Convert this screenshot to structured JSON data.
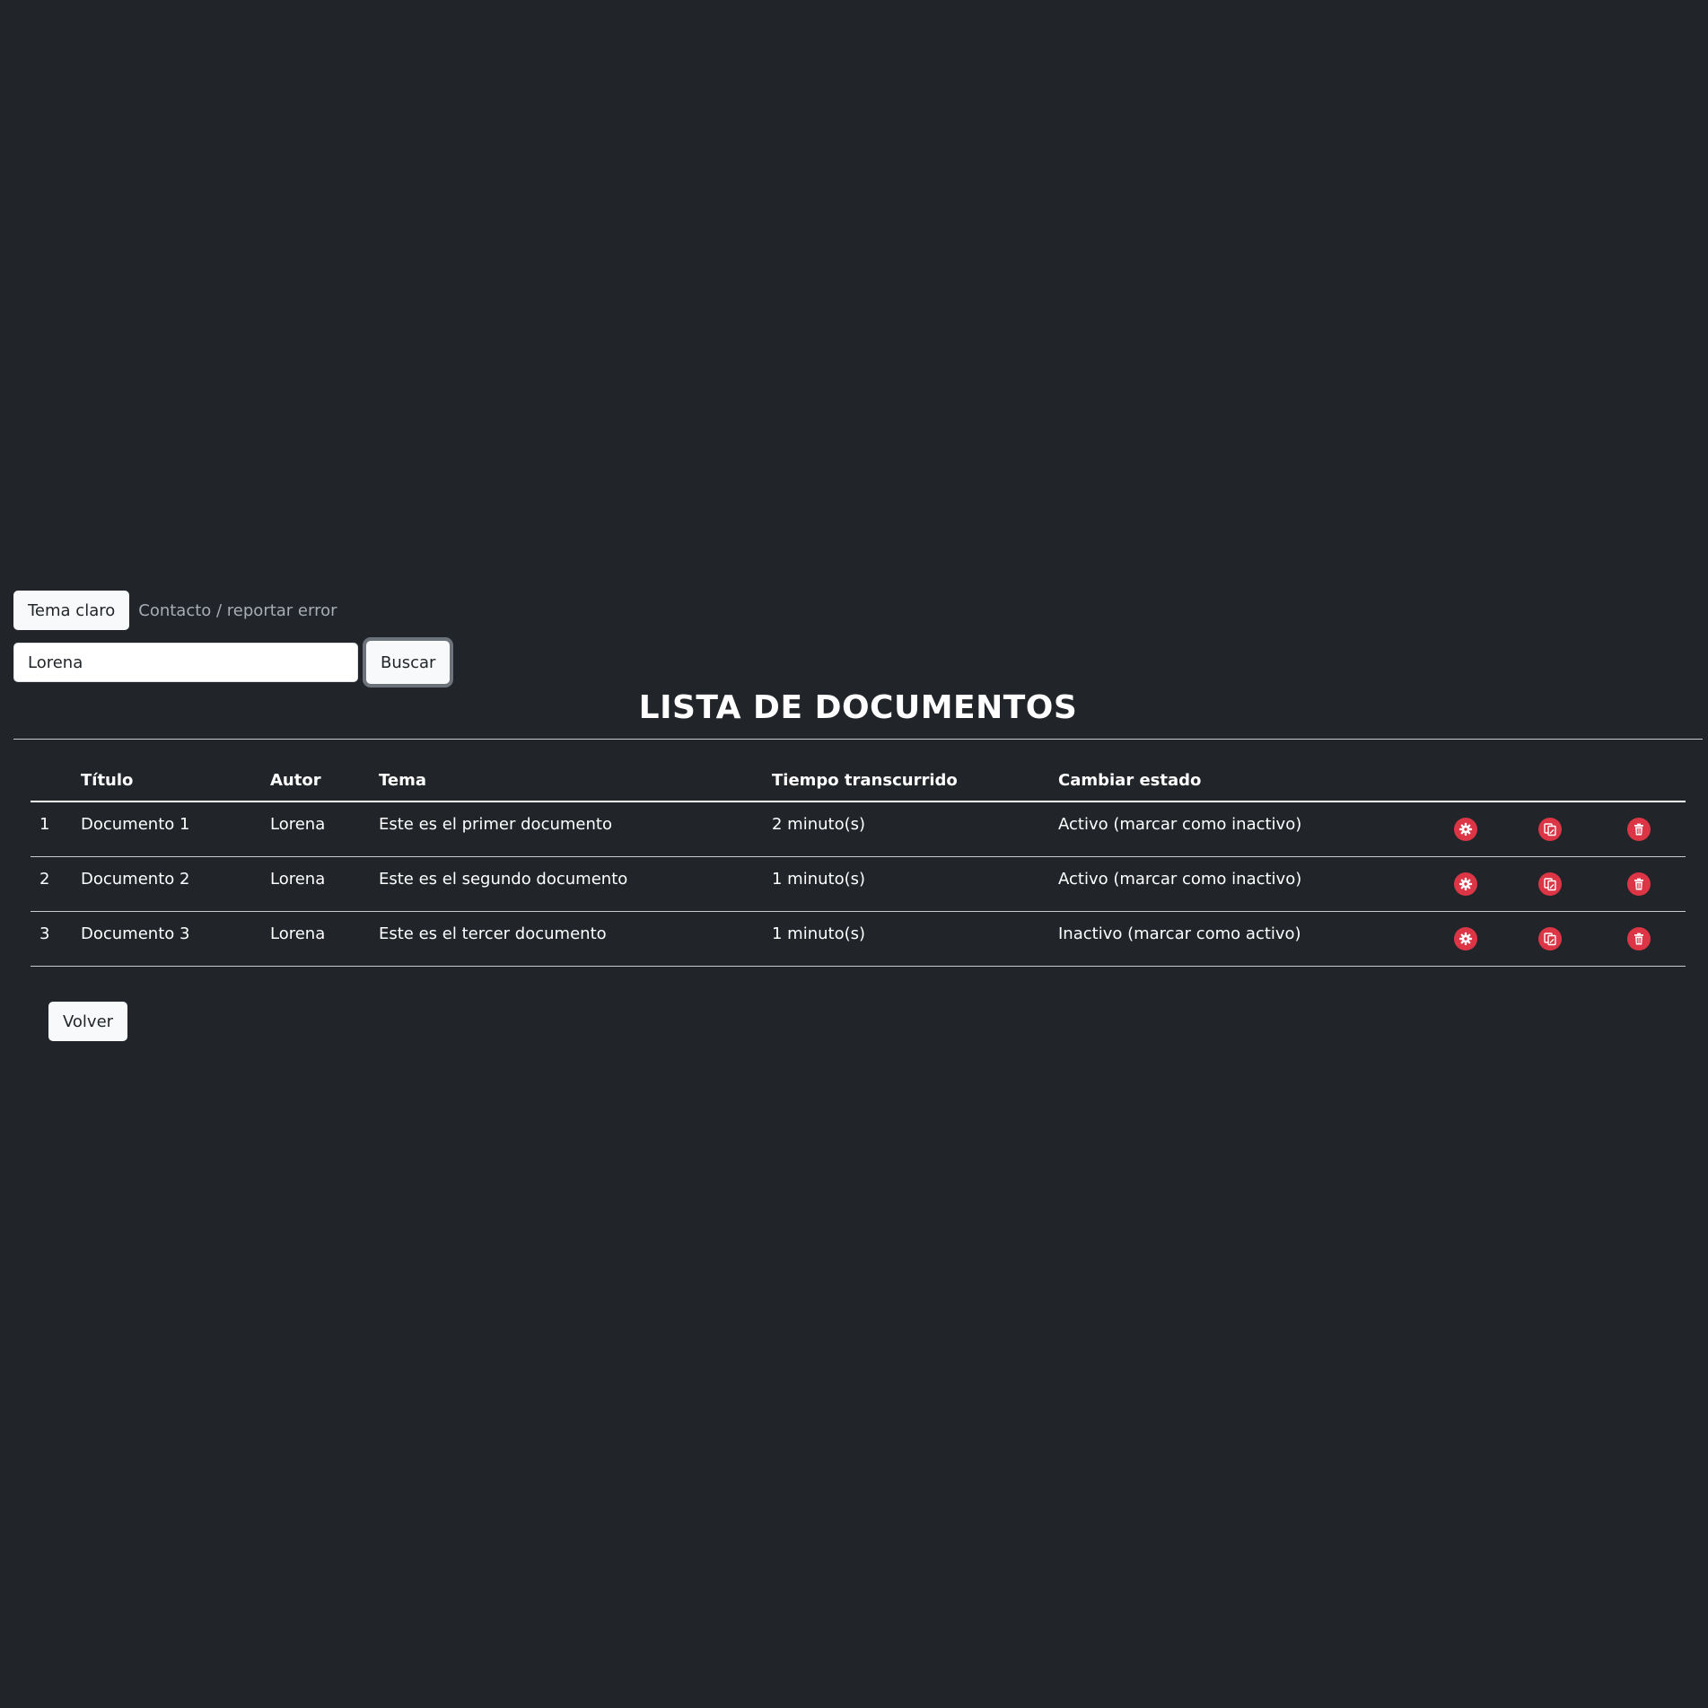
{
  "header": {
    "theme_button": "Tema claro",
    "contact_link": "Contacto / reportar error"
  },
  "search": {
    "value": "Lorena",
    "button": "Buscar"
  },
  "page_title": "LISTA DE DOCUMENTOS",
  "table": {
    "columns": [
      "",
      "Título",
      "Autor",
      "Tema",
      "Tiempo transcurrido",
      "Cambiar estado",
      "",
      "",
      ""
    ],
    "rows": [
      {
        "num": "1",
        "titulo": "Documento 1",
        "autor": "Lorena",
        "tema": "Este es el primer documento",
        "tiempo": "2 minuto(s)",
        "estado": "Activo (marcar como inactivo)"
      },
      {
        "num": "2",
        "titulo": "Documento 2",
        "autor": "Lorena",
        "tema": "Este es el segundo documento",
        "tiempo": "1 minuto(s)",
        "estado": "Activo (marcar como inactivo)"
      },
      {
        "num": "3",
        "titulo": "Documento 3",
        "autor": "Lorena",
        "tema": "Este es el tercer documento",
        "tiempo": "1 minuto(s)",
        "estado": "Inactivo (marcar como activo)"
      }
    ],
    "row_icons": [
      "gear-icon",
      "copy-edit-icon",
      "trash-icon"
    ]
  },
  "footer": {
    "back_button": "Volver"
  },
  "colors": {
    "background": "#212529",
    "accent": "#dc3545",
    "button_light": "#f8f9fa",
    "muted_text": "#a8adb3"
  }
}
